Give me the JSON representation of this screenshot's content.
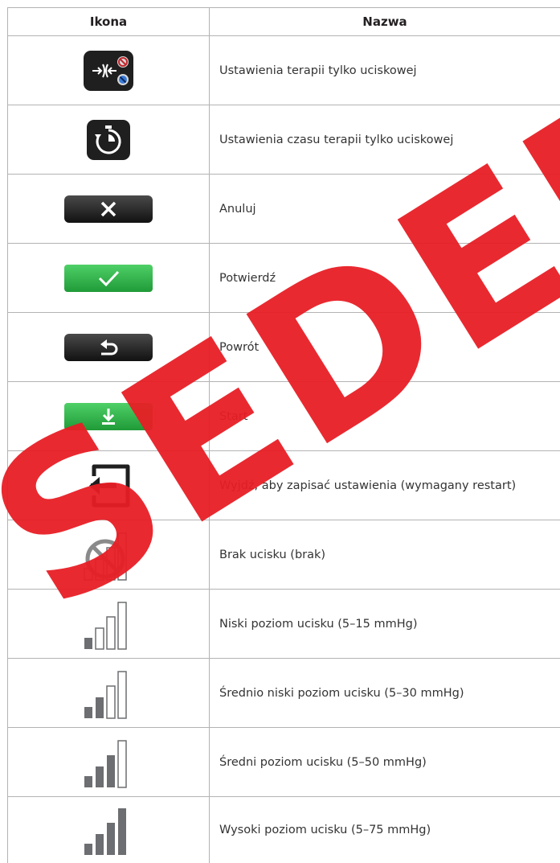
{
  "header": {
    "col_icon": "Ikona",
    "col_name": "Nazwa"
  },
  "rows": [
    {
      "icon": "compression-therapy-settings-icon",
      "name": "Ustawienia terapii tylko uciskowej"
    },
    {
      "icon": "compression-timer-settings-icon",
      "name": "Ustawienia czasu terapii tylko uciskowej"
    },
    {
      "icon": "cancel-x-icon",
      "name": "Anuluj"
    },
    {
      "icon": "confirm-check-icon",
      "name": "Potwierdź"
    },
    {
      "icon": "back-arrow-icon",
      "name": "Powrót"
    },
    {
      "icon": "start-download-icon",
      "name": "Start"
    },
    {
      "icon": "exit-save-icon",
      "name": "Wyjdź, aby zapisać ustawienia (wymagany restart)"
    },
    {
      "icon": "no-compression-icon",
      "name": "Brak ucisku (brak)"
    },
    {
      "icon": "compression-level-1-icon",
      "name": "Niski poziom ucisku (5–15 mmHg)"
    },
    {
      "icon": "compression-level-2-icon",
      "name": "Średnio niski poziom ucisku (5–30 mmHg)"
    },
    {
      "icon": "compression-level-3-icon",
      "name": "Średni poziom ucisku (5–50 mmHg)"
    },
    {
      "icon": "compression-level-4-icon",
      "name": "Wysoki poziom ucisku (5–75 mmHg)"
    }
  ],
  "watermark": "SEDED",
  "colors": {
    "dark_button": "#1f1f1f",
    "green_button": "#2fb84a",
    "watermark": "#e81e25",
    "bar": "#6d6e71"
  }
}
